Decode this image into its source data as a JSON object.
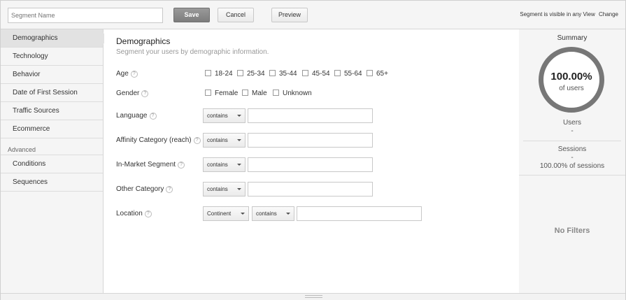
{
  "topbar": {
    "segment_name_placeholder": "Segment Name",
    "save_label": "Save",
    "cancel_label": "Cancel",
    "preview_label": "Preview",
    "visibility_text": "Segment is visible in any View",
    "change_label": "Change"
  },
  "sidebar": {
    "items": [
      {
        "label": "Demographics",
        "active": true
      },
      {
        "label": "Technology"
      },
      {
        "label": "Behavior"
      },
      {
        "label": "Date of First Session"
      },
      {
        "label": "Traffic Sources"
      },
      {
        "label": "Ecommerce"
      }
    ],
    "advanced_label": "Advanced",
    "advanced_items": [
      {
        "label": "Conditions"
      },
      {
        "label": "Sequences"
      }
    ]
  },
  "main": {
    "title": "Demographics",
    "subtitle": "Segment your users by demographic information.",
    "help_glyph": "?",
    "age": {
      "label": "Age",
      "options": [
        "18-24",
        "25-34",
        "35-44",
        "45-54",
        "55-64",
        "65+"
      ]
    },
    "gender": {
      "label": "Gender",
      "options": [
        "Female",
        "Male",
        "Unknown"
      ]
    },
    "language": {
      "label": "Language",
      "operator": "contains",
      "value": ""
    },
    "affinity": {
      "label": "Affinity Category (reach)",
      "operator": "contains",
      "value": ""
    },
    "inmarket": {
      "label": "In-Market Segment",
      "operator": "contains",
      "value": ""
    },
    "other": {
      "label": "Other Category",
      "operator": "contains",
      "value": ""
    },
    "location": {
      "label": "Location",
      "scope": "Continent",
      "operator": "contains",
      "value": ""
    }
  },
  "summary": {
    "title": "Summary",
    "percent": "100.00%",
    "percent_caption": "of users",
    "users_label": "Users",
    "users_value": "-",
    "sessions_label": "Sessions",
    "sessions_value": "-",
    "sessions_percent": "100.00% of sessions",
    "no_filters": "No Filters"
  }
}
